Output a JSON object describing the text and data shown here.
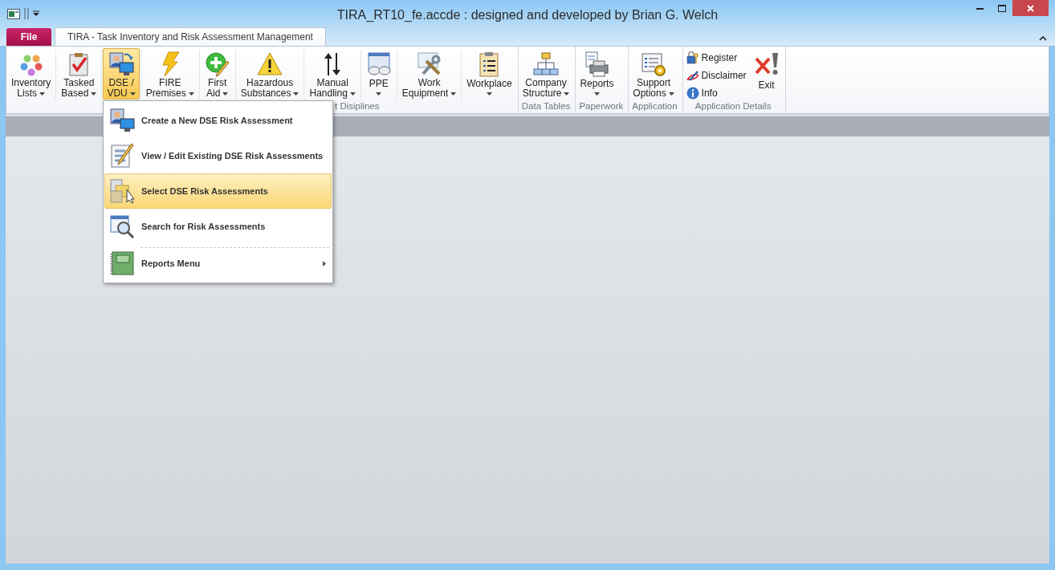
{
  "window": {
    "title": "TIRA_RT10_fe.accde : designed and developed by Brian G. Welch"
  },
  "tabs": [
    {
      "label": "File",
      "kind": "file",
      "selected": false
    },
    {
      "label": "TIRA - Task Inventory and Risk Assessment Management",
      "kind": "ribbon",
      "selected": true
    }
  ],
  "ribbon_groups": [
    {
      "label": "t Disiplines",
      "buttons": [
        {
          "kind": "large",
          "lines": [
            "Inventory",
            "Lists"
          ],
          "dropdown": true,
          "selected": false
        },
        {
          "kind": "large",
          "lines": [
            "Tasked",
            "Based"
          ],
          "dropdown": true,
          "selected": false
        },
        {
          "kind": "large",
          "lines": [
            "DSE /",
            "VDU"
          ],
          "dropdown": true,
          "selected": true
        },
        {
          "kind": "large",
          "lines": [
            "FIRE",
            "Premises"
          ],
          "dropdown": true,
          "selected": false
        },
        {
          "kind": "large",
          "lines": [
            "First",
            "Aid"
          ],
          "dropdown": true,
          "selected": false
        },
        {
          "kind": "large",
          "lines": [
            "Hazardous",
            "Substances"
          ],
          "dropdown": true,
          "selected": false
        },
        {
          "kind": "large",
          "lines": [
            "Manual",
            "Handling"
          ],
          "dropdown": true,
          "selected": false
        },
        {
          "kind": "large",
          "lines": [
            "PPE"
          ],
          "dropdown": true,
          "selected": false
        },
        {
          "kind": "large",
          "lines": [
            "Work",
            "Equipment"
          ],
          "dropdown": true,
          "selected": false
        },
        {
          "kind": "large",
          "lines": [
            "Workplace"
          ],
          "dropdown": true,
          "selected": false
        }
      ]
    },
    {
      "label": "Data Tables",
      "buttons": [
        {
          "kind": "large",
          "lines": [
            "Company",
            "Structure"
          ],
          "dropdown": true,
          "selected": false
        }
      ]
    },
    {
      "label": "Paperwork",
      "buttons": [
        {
          "kind": "large",
          "lines": [
            "Reports"
          ],
          "dropdown": true,
          "selected": false
        }
      ]
    },
    {
      "label": "Application",
      "buttons": [
        {
          "kind": "large",
          "lines": [
            "Support",
            "Options"
          ],
          "dropdown": true,
          "selected": false
        }
      ]
    },
    {
      "label": "Application Details",
      "buttons": [
        {
          "kind": "small",
          "lines": [
            "Register"
          ],
          "dropdown": false,
          "selected": false
        },
        {
          "kind": "small",
          "lines": [
            "Disclaimer"
          ],
          "dropdown": false,
          "selected": false
        },
        {
          "kind": "small",
          "lines": [
            "Info"
          ],
          "dropdown": false,
          "selected": false
        },
        {
          "kind": "large",
          "lines": [
            "Exit"
          ],
          "dropdown": false,
          "selected": false
        }
      ]
    }
  ],
  "menu": {
    "items": [
      {
        "label": "Create a New DSE Risk Assessment",
        "selected": false,
        "submenu": false,
        "separator_before": false
      },
      {
        "label": "View / Edit Existing DSE Risk Assessments",
        "selected": false,
        "submenu": false,
        "separator_before": false
      },
      {
        "label": "Select DSE Risk Assessments",
        "selected": true,
        "submenu": false,
        "separator_before": false
      },
      {
        "label": "Search for Risk Assessments",
        "selected": false,
        "submenu": false,
        "separator_before": false
      },
      {
        "label": "Reports Menu",
        "selected": false,
        "submenu": true,
        "separator_before": true
      }
    ]
  }
}
